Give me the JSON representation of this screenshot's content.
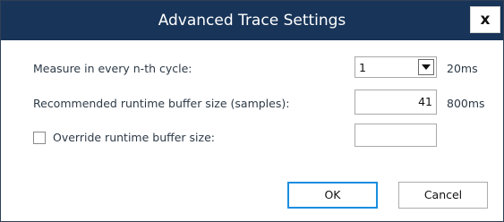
{
  "dialog": {
    "title": "Advanced Trace Settings",
    "close_label": "x"
  },
  "settings": {
    "measure_label": "Measure in every n-th cycle:",
    "measure_value": "1",
    "measure_suffix": "20ms",
    "buffer_label": "Recommended runtime buffer size (samples):",
    "buffer_value": "41",
    "buffer_suffix": "800ms",
    "override_label": "Override runtime buffer size:",
    "override_checked": false,
    "override_value": ""
  },
  "buttons": {
    "ok_label": "OK",
    "cancel_label": "Cancel"
  },
  "icons": {
    "dropdown": "chevron-down-icon"
  },
  "colors": {
    "titlebar": "#183458",
    "focus_border": "#1a8ee0"
  }
}
